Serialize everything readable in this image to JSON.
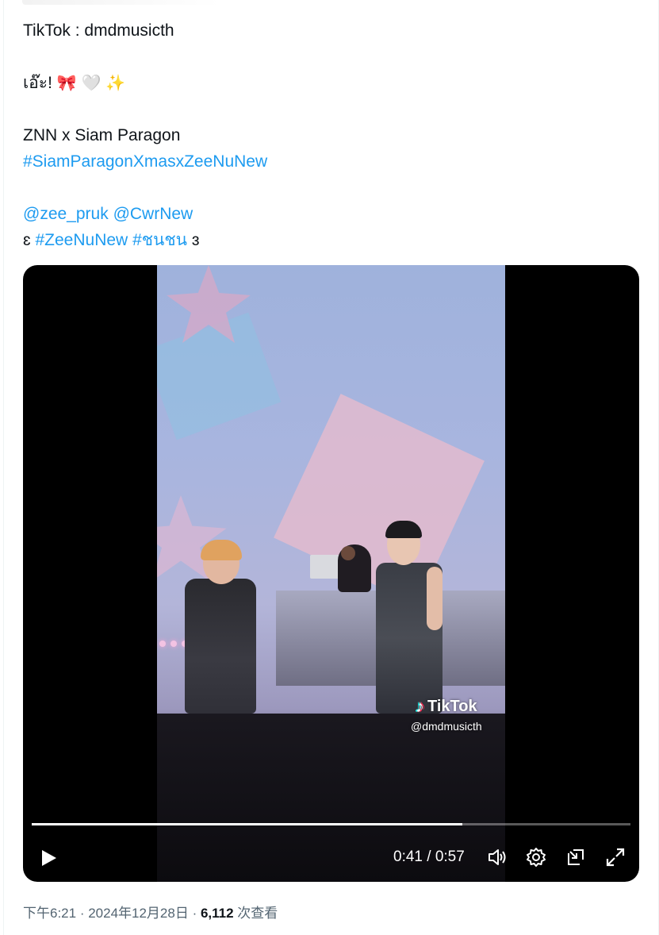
{
  "tweet": {
    "lines": [
      "TikTok : dmdmusicth",
      "",
      "เอ๊ะ! ",
      "",
      "ZNN x Siam Paragon",
      "#SiamParagonXmasxZeeNuNew",
      "",
      "@zee_pruk @CwrNew",
      "ɛ #ZeeNuNew #ชนชน ɜ"
    ],
    "line1": "TikTok : dmdmusicth",
    "line3_text": "เอ๊ะ! ",
    "line3_emoji": [
      "ribbon-emoji",
      "white-heart-emoji",
      "sparkles-emoji"
    ],
    "line3_emoji_glyphs": [
      "🎀",
      "🤍",
      "✨"
    ],
    "line5": "ZNN x Siam Paragon",
    "hashtag1": "#SiamParagonXmasxZeeNuNew",
    "mention1": "@zee_pruk",
    "mention2": "@CwrNew",
    "bracket_open": "ɛ",
    "hashtag2": "#ZeeNuNew",
    "hashtag3": "#ชนชน",
    "bracket_close": "ɜ"
  },
  "video": {
    "watermark_brand": "TikTok",
    "watermark_handle": "@dmdmusicth",
    "current_time": "0:41",
    "separator": " / ",
    "duration": "0:57",
    "progress": 0.719,
    "icons": [
      "play-icon",
      "volume-icon",
      "settings-icon",
      "picture-in-picture-icon",
      "fullscreen-icon"
    ]
  },
  "meta": {
    "time": "下午6:21",
    "dot1": " · ",
    "date": "2024年12月28日",
    "dot2": " · ",
    "views": "6,112",
    "views_label": " 次查看"
  },
  "colors": {
    "link": "#1d9bf0",
    "text": "#0f1419",
    "muted": "#536471"
  }
}
